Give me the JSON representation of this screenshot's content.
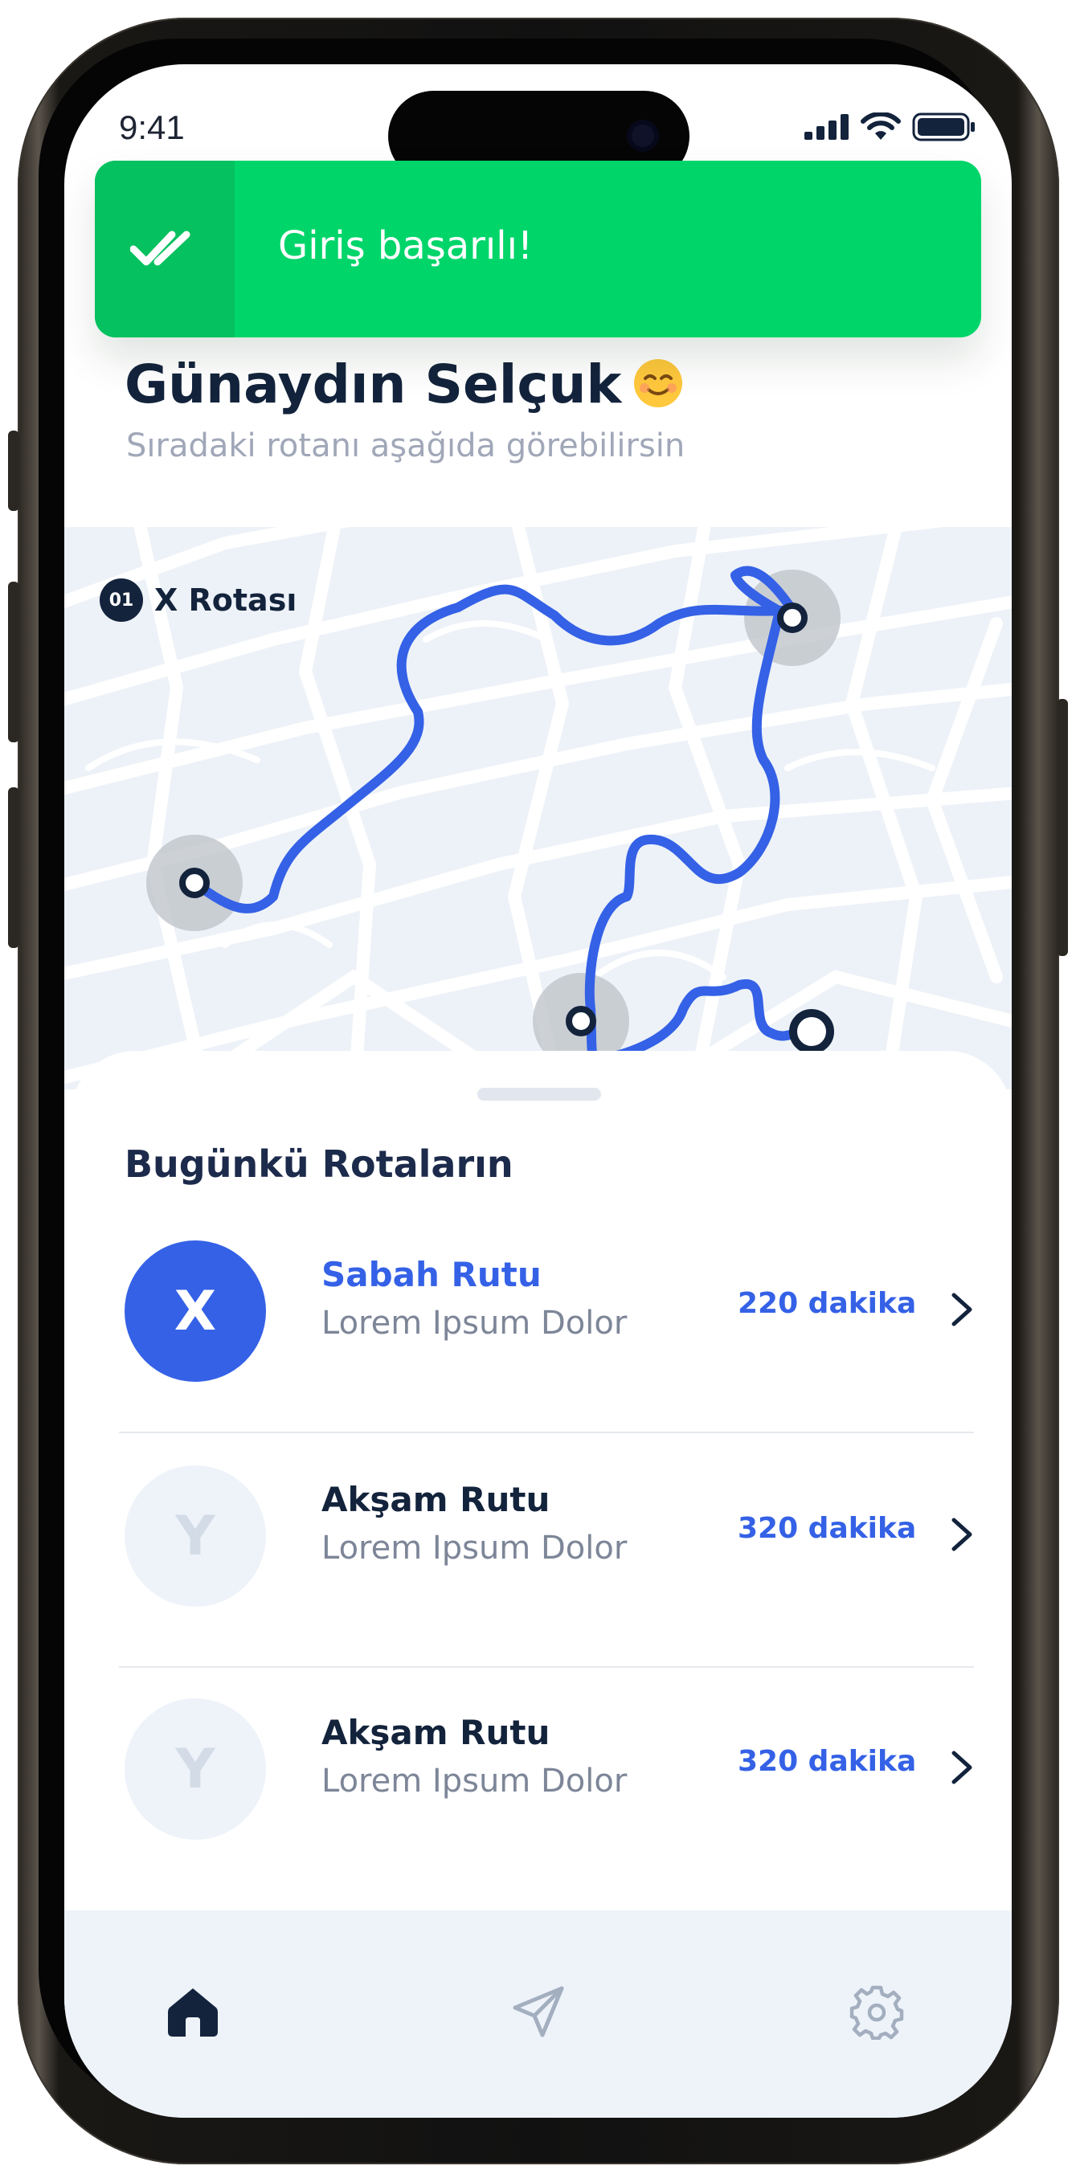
{
  "status_bar": {
    "time": "9:41"
  },
  "toast": {
    "message": "Giriş başarılı!",
    "icon": "double-check-icon",
    "color": "#00d56a"
  },
  "header": {
    "greeting": "Günaydın Selçuk",
    "emoji": "smiling-face-emoji",
    "subtitle": "Sıradaki rotanı aşağıda görebilirsin"
  },
  "map": {
    "route_badge": "01",
    "route_name": "X Rotası",
    "route_color": "#3461e6"
  },
  "sheet": {
    "title": "Bugünkü Rotaların",
    "routes": [
      {
        "avatar": "X",
        "name": "Sabah Rutu",
        "desc": "Lorem Ipsum Dolor",
        "minutes": "220 dakika",
        "active": true
      },
      {
        "avatar": "Y",
        "name": "Akşam Rutu",
        "desc": "Lorem Ipsum Dolor",
        "minutes": "320 dakika",
        "active": false
      },
      {
        "avatar": "Y",
        "name": "Akşam Rutu",
        "desc": "Lorem Ipsum Dolor",
        "minutes": "320 dakika",
        "active": false
      }
    ]
  },
  "tabbar": {
    "tabs": [
      "home-icon",
      "send-icon",
      "settings-icon"
    ],
    "active": "home-icon"
  },
  "colors": {
    "primary": "#3461e6",
    "dark": "#13233c",
    "success": "#00d56a"
  }
}
